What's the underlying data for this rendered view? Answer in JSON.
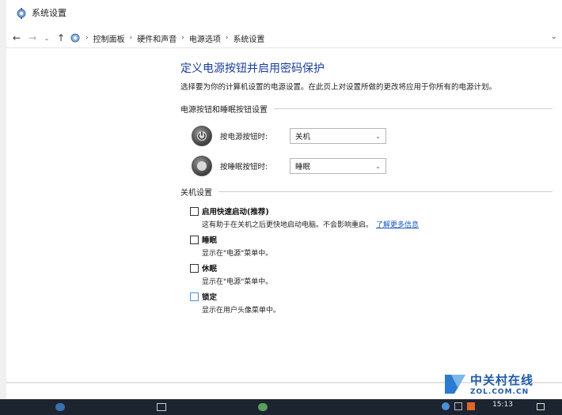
{
  "window": {
    "title": "系统设置"
  },
  "address": {
    "crumbs": [
      "控制面板",
      "硬件和声音",
      "电源选项",
      "系统设置"
    ],
    "sep": "›"
  },
  "nav": {
    "back": "←",
    "forward": "→",
    "recent": "⌄",
    "up": "↑",
    "dropdown": "⌄"
  },
  "page": {
    "title": "定义电源按钮并启用密码保护",
    "description": "选择要为你的计算机设置的电源设置。在此页上对设置所做的更改将应用于你所有的电源计划。"
  },
  "power_section": {
    "heading": "电源按钮和睡眠按钮设置",
    "rows": [
      {
        "label": "按电源按钮时:",
        "value": "关机",
        "icon": "power-button-icon"
      },
      {
        "label": "按睡眠按钮时:",
        "value": "睡眠",
        "icon": "sleep-button-icon"
      }
    ]
  },
  "shutdown_section": {
    "heading": "关机设置",
    "items": [
      {
        "label": "启用快速启动(推荐)",
        "desc": "这有助于在关机之后更快地启动电脑。不会影响重启。",
        "link": "了解更多信息",
        "checked": false
      },
      {
        "label": "睡眠",
        "desc": "显示在\"电源\"菜单中。",
        "checked": false
      },
      {
        "label": "休眠",
        "desc": "显示在\"电源\"菜单中。",
        "checked": false
      },
      {
        "label": "锁定",
        "desc": "显示在用户头像菜单中。",
        "checked": false
      }
    ]
  },
  "taskbar": {
    "clock": "15:13"
  },
  "watermark": {
    "cn": "中关村在线",
    "en": "ZOL.COM.CN"
  },
  "colors": {
    "title_blue": "#1a3e9c",
    "link_blue": "#1a57c2",
    "taskbar": "#1c2430"
  }
}
